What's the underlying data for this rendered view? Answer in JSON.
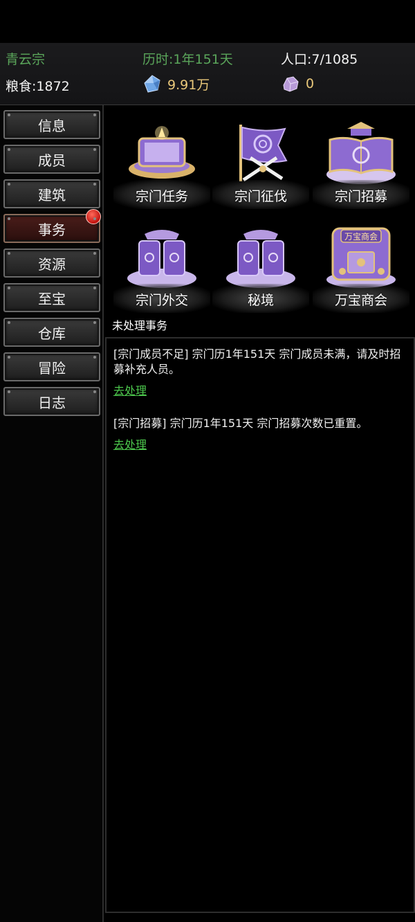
{
  "header": {
    "sect_name": "青云宗",
    "time": "历时:1年151天",
    "population": "人口:7/1085",
    "food": "粮食:1872",
    "spirit_stone": "9.91万",
    "spirit_ore": "0"
  },
  "sidebar": {
    "items": [
      {
        "label": "信息"
      },
      {
        "label": "成员"
      },
      {
        "label": "建筑"
      },
      {
        "label": "事务",
        "active": true,
        "badge": true
      },
      {
        "label": "资源"
      },
      {
        "label": "至宝"
      },
      {
        "label": "仓库"
      },
      {
        "label": "冒险"
      },
      {
        "label": "日志"
      }
    ]
  },
  "actions": [
    {
      "label": "宗门任务",
      "icon": "scroll-altar-icon"
    },
    {
      "label": "宗门征伐",
      "icon": "war-flag-icon"
    },
    {
      "label": "宗门招募",
      "icon": "recruit-book-icon"
    },
    {
      "label": "宗门外交",
      "icon": "diplomacy-cards-icon"
    },
    {
      "label": "秘境",
      "icon": "secret-realm-cards-icon"
    },
    {
      "label": "万宝商会",
      "icon": "treasure-chest-icon",
      "sign": "万宝商会"
    }
  ],
  "pending": {
    "title": "未处理事务",
    "events": [
      {
        "text": "[宗门成员不足] 宗门历1年151天 宗门成员未满，请及时招募补充人员。",
        "link": "去处理"
      },
      {
        "text": "[宗门招募] 宗门历1年151天 宗门招募次数已重置。",
        "link": "去处理"
      }
    ]
  },
  "colors": {
    "accent_green": "#5aa55a",
    "link_green": "#4dc84d",
    "currency_gold": "#e9c87a",
    "badge_red": "#c1120e",
    "icon_purple": "#8d6bd1"
  }
}
